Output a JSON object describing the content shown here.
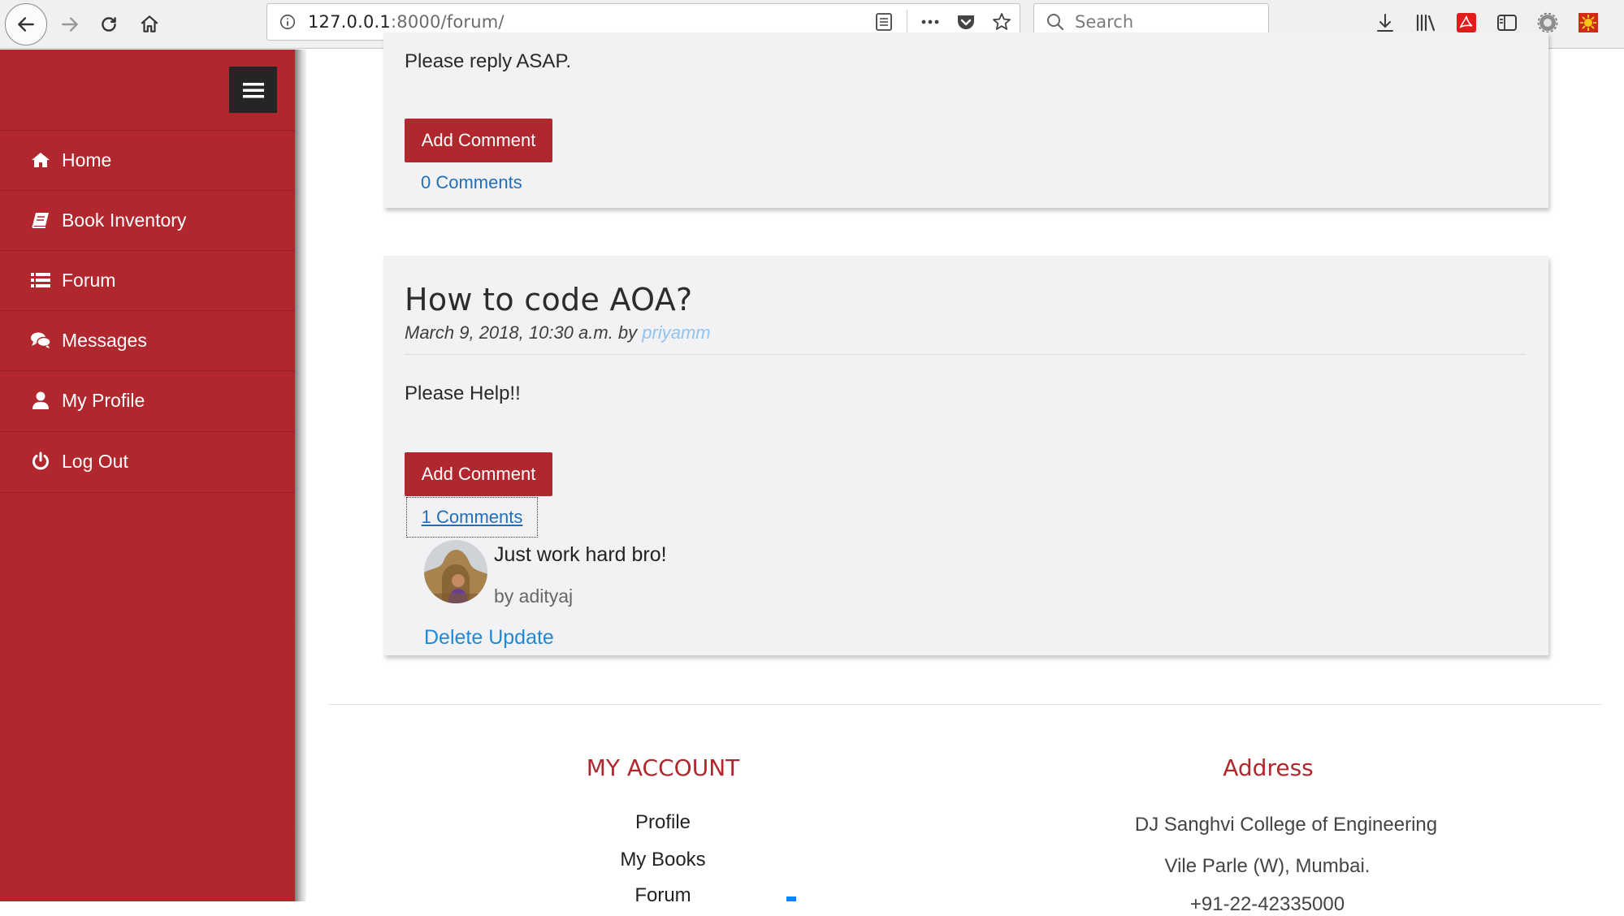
{
  "browser": {
    "url_host": "127.0.0.1",
    "url_path": ":8000/forum/",
    "search_placeholder": "Search"
  },
  "sidebar": {
    "items": [
      {
        "label": "Home",
        "icon": "home-icon"
      },
      {
        "label": "Book Inventory",
        "icon": "book-icon"
      },
      {
        "label": "Forum",
        "icon": "list-icon"
      },
      {
        "label": "Messages",
        "icon": "comments-icon"
      },
      {
        "label": "My Profile",
        "icon": "user-icon"
      },
      {
        "label": "Log Out",
        "icon": "power-icon"
      }
    ]
  },
  "posts": [
    {
      "body": "Please reply ASAP.",
      "add_comment_label": "Add Comment",
      "comments_label": "0 Comments"
    },
    {
      "title": "How to code AOA?",
      "meta_prefix": "March 9, 2018, 10:30 a.m. by",
      "author": "priyamm",
      "body": "Please Help!!",
      "add_comment_label": "Add Comment",
      "comments_label": "1 Comments",
      "comment": {
        "text": "Just work hard bro!",
        "by": "by adityaj",
        "delete_label": "Delete Update"
      }
    }
  ],
  "footer": {
    "account_heading": "MY ACCOUNT",
    "account_links": [
      "Profile",
      "My Books",
      "Forum"
    ],
    "address_heading": "Address",
    "address_lines": [
      "DJ Sanghvi College of Engineering",
      "Vile Parle (W), Mumbai.",
      "+91-22-42335000"
    ]
  },
  "colors": {
    "brand_red": "#b0272d",
    "link_blue": "#1f6fb8"
  }
}
